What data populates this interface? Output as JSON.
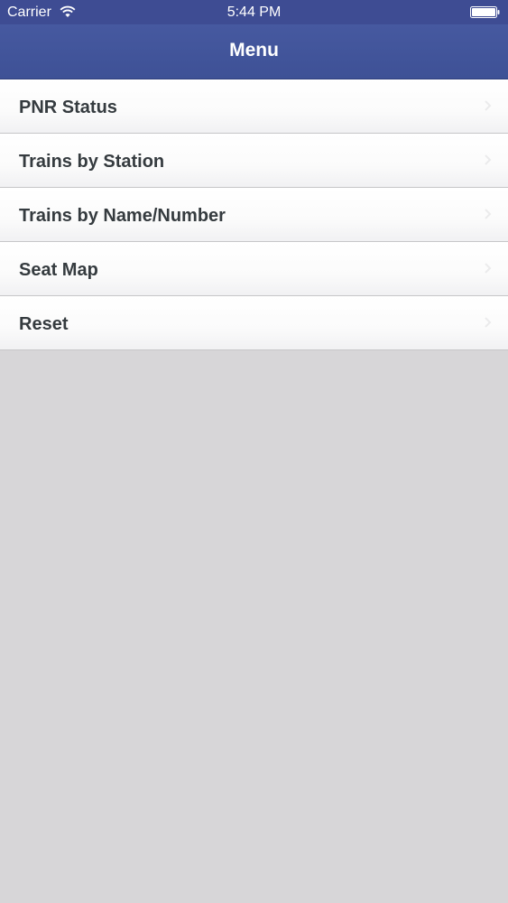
{
  "status_bar": {
    "carrier": "Carrier",
    "time": "5:44 PM",
    "wifi_icon": "wifi-icon",
    "battery_icon": "battery-icon"
  },
  "nav_bar": {
    "title": "Menu",
    "color": "#4357a0"
  },
  "menu": {
    "items": [
      {
        "label": "PNR Status"
      },
      {
        "label": "Trains by Station"
      },
      {
        "label": "Trains by Name/Number"
      },
      {
        "label": "Seat Map"
      },
      {
        "label": "Reset"
      }
    ]
  },
  "colors": {
    "background": "#d7d6d8",
    "item_text": "#353b3f"
  }
}
